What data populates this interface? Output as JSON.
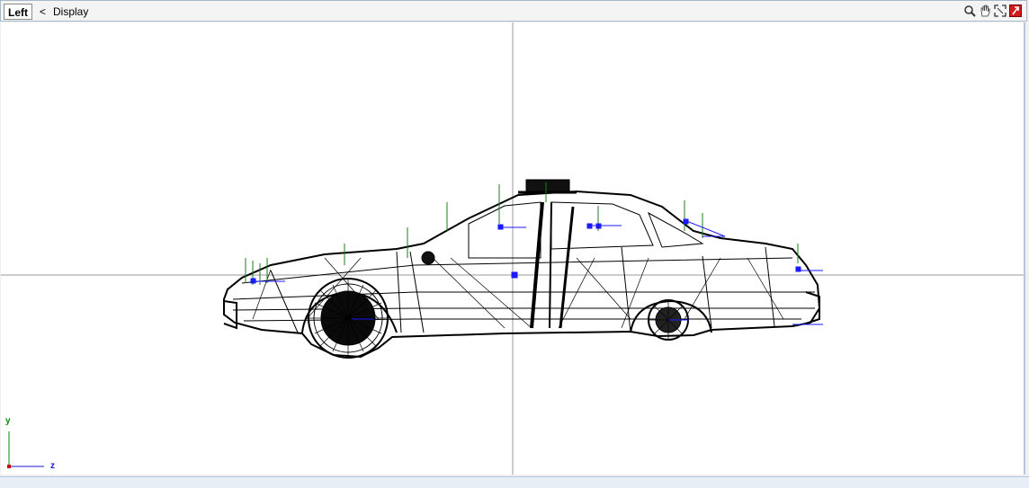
{
  "toolbar": {
    "view_name": "Left",
    "collapse_symbol": "<",
    "menu_label": "Display",
    "icons": [
      "zoom-icon",
      "pan-hand-icon",
      "maximize-icon",
      "close-viewport-icon"
    ]
  },
  "viewport": {
    "axis_y_label": "y",
    "axis_z_label": "z",
    "colors": {
      "background": "#ffffff",
      "grid_lines": "#9a9a9a",
      "wireframe": "#000000",
      "normals_green": "#1d7a1d",
      "handles_blue": "#1a1aff",
      "axis_y": "#0a8a0a",
      "axis_z": "#1a1ad0",
      "axis_origin": "#cc0000"
    }
  }
}
